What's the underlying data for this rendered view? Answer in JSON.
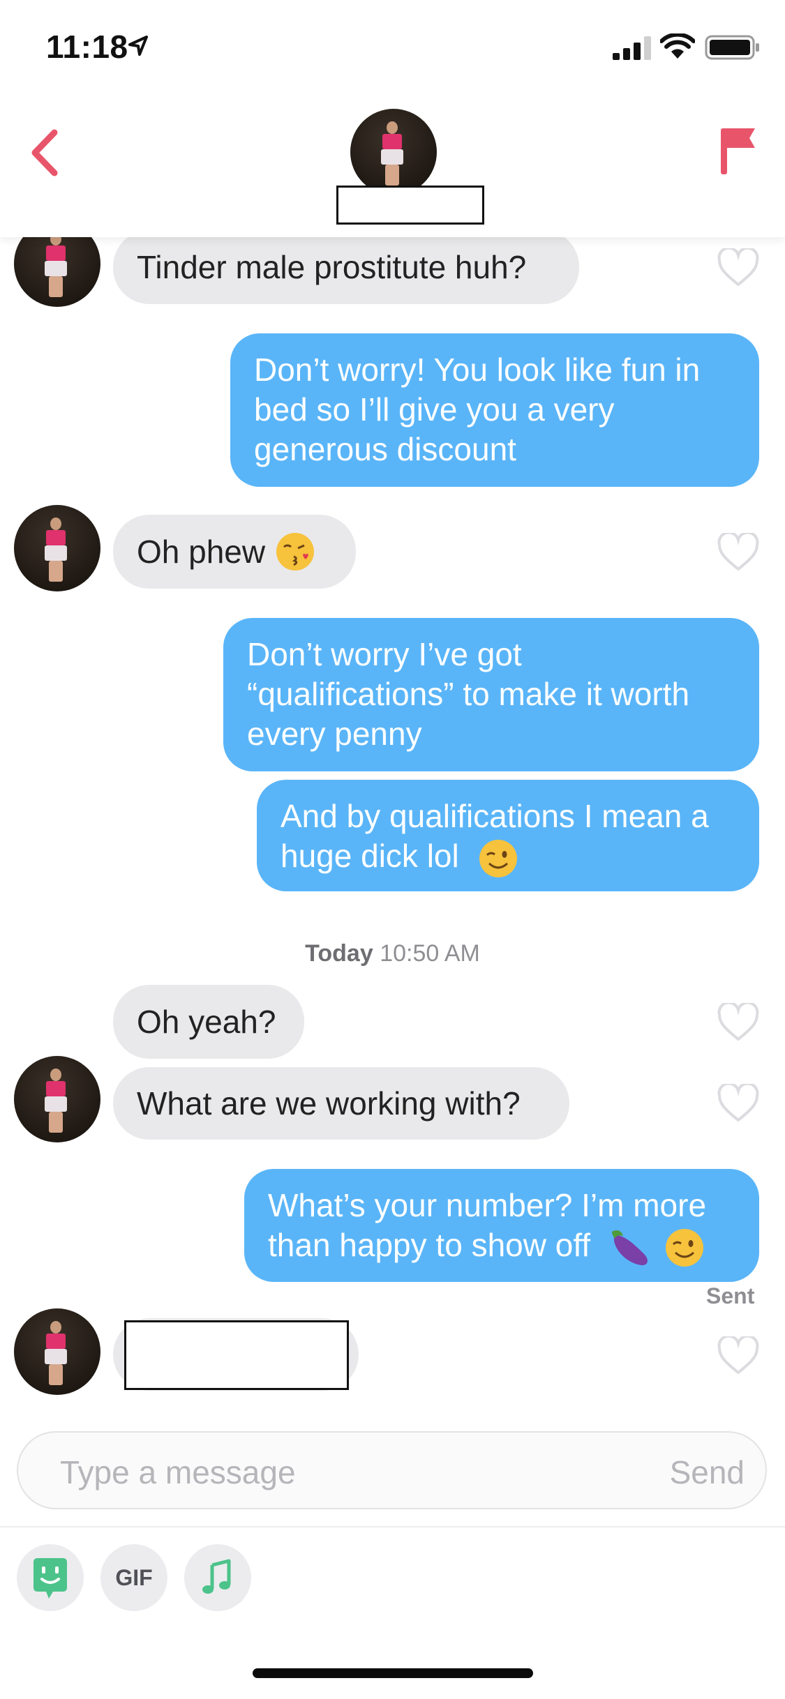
{
  "status_bar": {
    "time": "11:18"
  },
  "header": {
    "back_icon": "chevron-left-icon",
    "flag_icon": "flag-icon",
    "accent": "#e8556a"
  },
  "messages": [
    {
      "from": "them",
      "text": "Tinder male prostitute huh?"
    },
    {
      "from": "me",
      "lines": [
        "Don’t worry! You look like fun in",
        "bed so I’ll give you a very",
        "generous discount"
      ]
    },
    {
      "from": "them",
      "text": "Oh phew",
      "emoji": "kissing-face-emoji"
    },
    {
      "from": "me",
      "lines": [
        "Don’t worry I’ve got",
        "“qualifications” to make it worth",
        "every penny"
      ]
    },
    {
      "from": "me",
      "lines": [
        "And by qualifications I mean a",
        "huge dick lol"
      ],
      "emoji": "winking-face-emoji"
    },
    {
      "from": "them",
      "text": "Oh yeah?"
    },
    {
      "from": "them",
      "text": "What are we working with?"
    },
    {
      "from": "me",
      "lines": [
        "What’s your number? I’m more",
        "than happy to show off"
      ],
      "emoji": "eggplant-and-wink-emoji"
    }
  ],
  "timestamp": {
    "day": "Today",
    "time": "10:50 AM"
  },
  "sent_label": "Sent",
  "composer": {
    "placeholder": "Type a message",
    "send_label": "Send"
  },
  "toolbar": {
    "gif_label": "GIF"
  },
  "colors": {
    "outgoing_bubble": "#5ab5f8",
    "incoming_bubble": "#e9e9eb",
    "sticker_green": "#4cc38a"
  }
}
